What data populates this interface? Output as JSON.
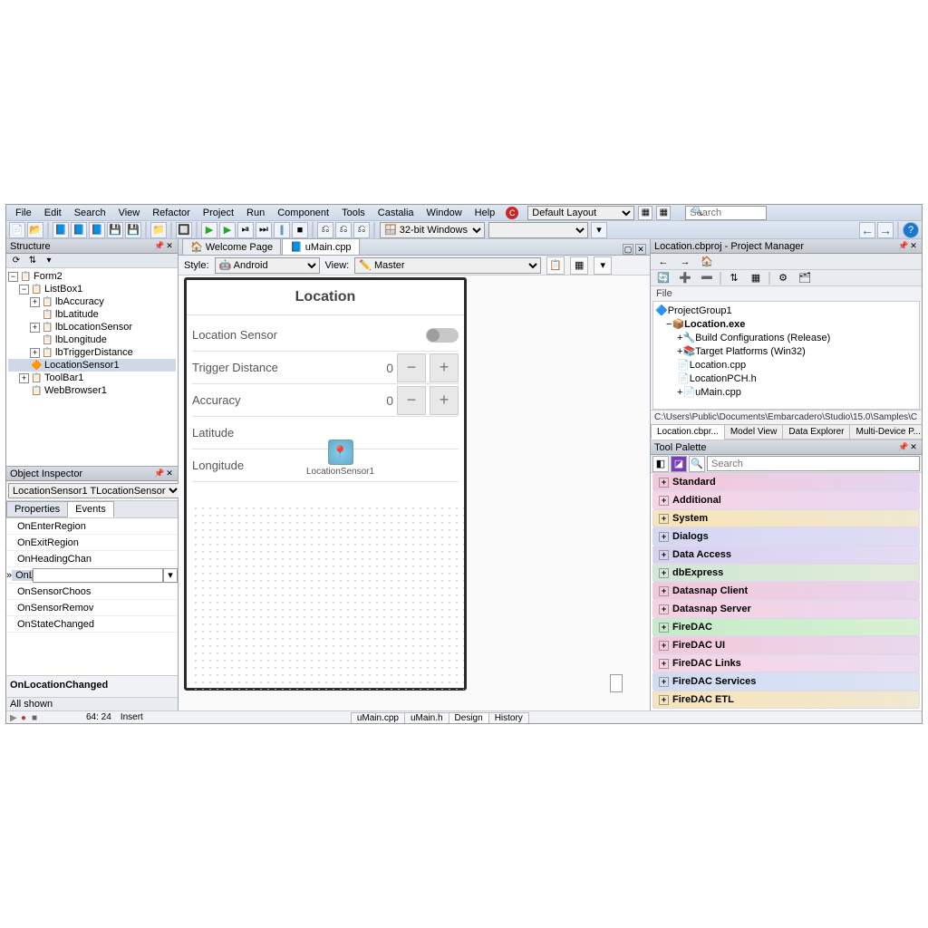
{
  "menubar": {
    "items": [
      "File",
      "Edit",
      "Search",
      "View",
      "Refactor",
      "Project",
      "Run",
      "Component",
      "Tools",
      "Castalia",
      "Window",
      "Help"
    ],
    "layout": "Default Layout",
    "search_ph": "Search"
  },
  "toolbar2": {
    "target": "32-bit Windows"
  },
  "structure": {
    "title": "Structure",
    "nodes": [
      {
        "label": "Form2",
        "lvl": 0,
        "exp": "−",
        "icon": "📋"
      },
      {
        "label": "ListBox1",
        "lvl": 1,
        "exp": "−",
        "icon": "📋"
      },
      {
        "label": "lbAccuracy",
        "lvl": 2,
        "exp": "+",
        "icon": "📋"
      },
      {
        "label": "lbLatitude",
        "lvl": 2,
        "exp": "",
        "icon": "📋"
      },
      {
        "label": "lbLocationSensor",
        "lvl": 2,
        "exp": "+",
        "icon": "📋"
      },
      {
        "label": "lbLongitude",
        "lvl": 2,
        "exp": "",
        "icon": "📋"
      },
      {
        "label": "lbTriggerDistance",
        "lvl": 2,
        "exp": "+",
        "icon": "📋"
      },
      {
        "label": "LocationSensor1",
        "lvl": 1,
        "exp": "",
        "icon": "🔶",
        "sel": true
      },
      {
        "label": "ToolBar1",
        "lvl": 1,
        "exp": "+",
        "icon": "📋"
      },
      {
        "label": "WebBrowser1",
        "lvl": 1,
        "exp": "",
        "icon": "📋"
      }
    ]
  },
  "oi": {
    "title": "Object Inspector",
    "selection": "LocationSensor1  TLocationSensor",
    "tabs": [
      "Properties",
      "Events"
    ],
    "active_tab": 1,
    "rows": [
      "OnEnterRegion",
      "OnExitRegion",
      "OnHeadingChan",
      "OnLocationChan",
      "OnSensorChoos",
      "OnSensorRemov",
      "OnStateChanged"
    ],
    "current_row": 3,
    "footer": "OnLocationChanged",
    "status": "All shown"
  },
  "editor": {
    "tabs": [
      {
        "label": "Welcome Page",
        "icon": "🏠"
      },
      {
        "label": "uMain.cpp",
        "icon": "📘",
        "active": true
      }
    ],
    "style": "Android",
    "view": "Master",
    "cursor": "64: 24",
    "mode": "Insert",
    "bottom": [
      {
        "l": "uMain.cpp"
      },
      {
        "l": "uMain.h"
      },
      {
        "l": "Design",
        "a": true
      },
      {
        "l": "History"
      }
    ]
  },
  "form": {
    "title": "Location",
    "rows": [
      {
        "name": "Location Sensor",
        "type": "switch"
      },
      {
        "name": "Trigger Distance",
        "type": "spin",
        "val": "0"
      },
      {
        "name": "Accuracy",
        "type": "spin",
        "val": "0"
      },
      {
        "name": "Latitude",
        "type": "text"
      },
      {
        "name": "Longitude",
        "type": "text"
      }
    ],
    "sensor_component": "LocationSensor1"
  },
  "pm": {
    "title": "Location.cbproj - Project Manager",
    "file_lbl": "File",
    "tree": [
      {
        "label": "ProjectGroup1",
        "lvl": 0,
        "icon": "🔷"
      },
      {
        "label": "Location.exe",
        "lvl": 1,
        "icon": "📦",
        "exp": "−",
        "bold": true
      },
      {
        "label": "Build Configurations (Release)",
        "lvl": 2,
        "icon": "🔧",
        "exp": "+"
      },
      {
        "label": "Target Platforms (Win32)",
        "lvl": 2,
        "icon": "📚",
        "exp": "+"
      },
      {
        "label": "Location.cpp",
        "lvl": 2,
        "icon": "📄"
      },
      {
        "label": "LocationPCH.h",
        "lvl": 2,
        "icon": "📄"
      },
      {
        "label": "uMain.cpp",
        "lvl": 2,
        "icon": "📄",
        "exp": "+"
      }
    ],
    "path": "C:\\Users\\Public\\Documents\\Embarcadero\\Studio\\15.0\\Samples\\C",
    "tabs": [
      "Location.cbpr...",
      "Model View",
      "Data Explorer",
      "Multi-Device P..."
    ]
  },
  "tp": {
    "title": "Tool Palette",
    "search_ph": "Search",
    "cats": [
      {
        "l": "Standard",
        "c": "linear-gradient(90deg,#f4c8da,#e4d4f0)"
      },
      {
        "l": "Additional",
        "c": "linear-gradient(90deg,#f8d4e4,#e8d8f2)"
      },
      {
        "l": "System",
        "c": "linear-gradient(90deg,#f8e4b8,#f0e8d0)"
      },
      {
        "l": "Dialogs",
        "c": "linear-gradient(90deg,#d4d8f4,#e0dcf4)"
      },
      {
        "l": "Data Access",
        "c": "linear-gradient(90deg,#d8d0f0,#e4dcf4)"
      },
      {
        "l": "dbExpress",
        "c": "linear-gradient(90deg,#d0e8d4,#e0ecd8)"
      },
      {
        "l": "Datasnap Client",
        "c": "linear-gradient(90deg,#f4c8da,#e8d4ec)"
      },
      {
        "l": "Datasnap Server",
        "c": "linear-gradient(90deg,#f8d0e0,#ecd8f0)"
      },
      {
        "l": "FireDAC",
        "c": "linear-gradient(90deg,#c4ecc8,#d8f0d4)"
      },
      {
        "l": "FireDAC UI",
        "c": "linear-gradient(90deg,#f4c8da,#e8d8ec)"
      },
      {
        "l": "FireDAC Links",
        "c": "linear-gradient(90deg,#f8d4e4,#ecdcf0)"
      },
      {
        "l": "FireDAC Services",
        "c": "linear-gradient(90deg,#d0dcf4,#dce4f4)"
      },
      {
        "l": "FireDAC ETL",
        "c": "linear-gradient(90deg,#f8e4b8,#f0e8d0)"
      }
    ]
  }
}
